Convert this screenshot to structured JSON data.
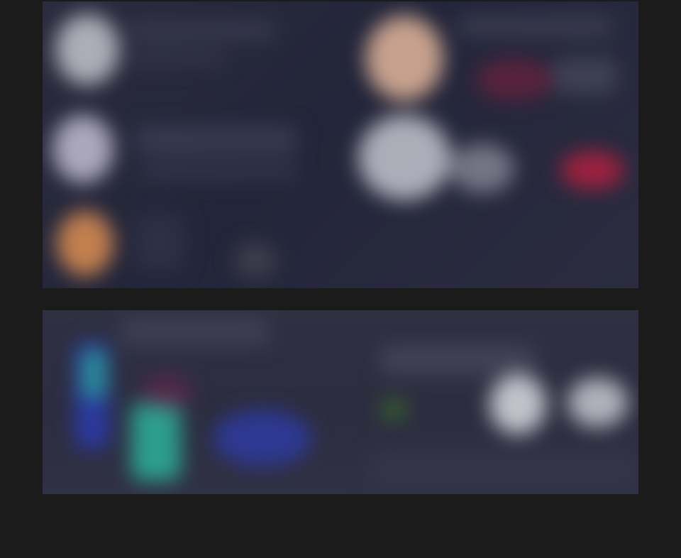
{
  "page": {
    "background": "#1b1b1c"
  },
  "panels": [
    {
      "id": "top",
      "colors": {
        "base": "#25263a",
        "avatar_gray": "#c9c9d2",
        "avatar_lavender": "#c7c2d8",
        "avatar_orange": "#d98b4f",
        "portrait_skin": "#e6b9a0",
        "accent_red": "#b3203f"
      }
    },
    {
      "id": "bottom",
      "colors": {
        "base": "#2d2e40",
        "accent_teal": "#2fb8a0",
        "accent_blue": "#2f3fb0",
        "accent_white": "#d8d8de"
      }
    }
  ]
}
